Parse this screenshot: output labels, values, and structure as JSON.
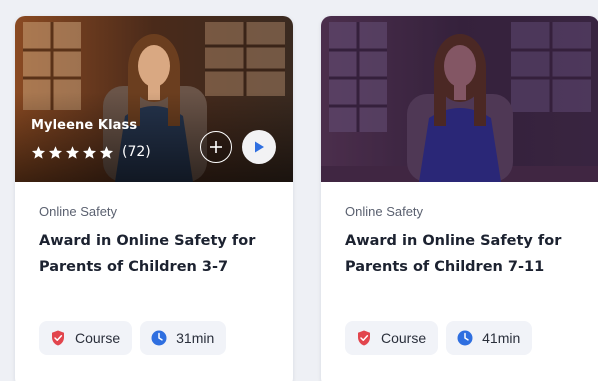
{
  "cards": [
    {
      "instructor": "Myleene Klass",
      "rating_count": "(72)",
      "stars": 5,
      "category": "Online Safety",
      "title_line1": "Award in Online Safety for",
      "title_line2": "Parents of Children 3-7",
      "tag_type": "Course",
      "tag_duration": "31min",
      "overlay": "hover"
    },
    {
      "category": "Online Safety",
      "title_line1": "Award in Online Safety for",
      "title_line2": "Parents of Children 7-11",
      "tag_type": "Course",
      "tag_duration": "41min",
      "overlay": "purple"
    }
  ],
  "icons": {
    "add": "plus-circle-icon",
    "play": "play-icon",
    "course": "shield-check-icon",
    "duration": "clock-icon",
    "star": "star-icon"
  },
  "colors": {
    "shield": "#e2454d",
    "clock": "#2f6fe0",
    "play": "#2f6fe0",
    "title": "#1c2230",
    "category": "#5b6170",
    "tag_bg": "#f1f3f8"
  }
}
